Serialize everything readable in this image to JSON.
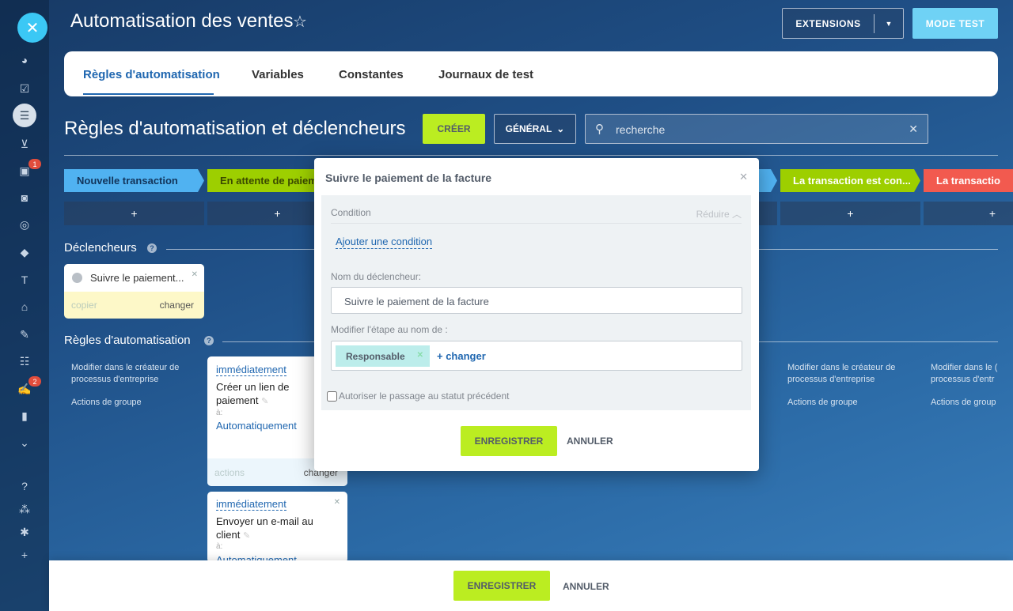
{
  "sidebar": {
    "close_icon": "✕",
    "badges": [
      "1",
      "2"
    ],
    "icons": [
      "pie-chart-icon",
      "check-square-icon",
      "funnel-icon",
      "cart-icon",
      "contact-card-icon",
      "robot-icon",
      "target-icon",
      "box-icon",
      "t-letter-icon",
      "bank-icon",
      "signature-icon",
      "checklist-icon",
      "tasks-icon",
      "bar-chart-icon",
      "chevron-down-icon",
      "help-icon",
      "sitemap-icon",
      "gear-icon",
      "plus-icon"
    ]
  },
  "header": {
    "title": "Automatisation des ventes",
    "star": "☆",
    "extensions_label": "EXTENSIONS",
    "mode_test_label": "MODE TEST"
  },
  "tabs": [
    {
      "label": "Règles d'automatisation"
    },
    {
      "label": "Variables"
    },
    {
      "label": "Constantes"
    },
    {
      "label": "Journaux de test"
    }
  ],
  "section": {
    "title": "Règles d'automatisation et déclencheurs",
    "create_label": "CRÉER",
    "general_label": "GÉNÉRAL",
    "search_placeholder": "recherche"
  },
  "stages": [
    {
      "label": "Nouvelle transaction",
      "color": "#50b2f1"
    },
    {
      "label": "En attente de paiement",
      "color": "#9dcf00"
    },
    {
      "label": "La transaction est con...",
      "color": "#9dcf00"
    },
    {
      "label": "La transactio",
      "color": "#f25a4f"
    }
  ],
  "plus_label": "+",
  "triggers": {
    "title": "Déclencheurs",
    "card": {
      "name": "Suivre le paiement...",
      "copy": "copier",
      "change": "changer"
    }
  },
  "robots": {
    "title": "Règles d'automatisation",
    "create_in_designer": "Modifier dans le créateur de processus d'entreprise",
    "create_in_designer_short": "Modifier dans le créateur de processus d'entr",
    "group_actions": "Actions de groupe",
    "group_actions_short": "Actions de group",
    "cards": [
      {
        "when": "immédiatement",
        "title": "Créer un lien de paiement",
        "to": "à:",
        "who": "Automatiquement",
        "actions": "actions",
        "change": "changer"
      },
      {
        "when": "immédiatement",
        "title": "Envoyer un e-mail au client",
        "to": "à:",
        "who": "Automatiquement"
      }
    ]
  },
  "modal": {
    "title": "Suivre le paiement de la facture",
    "condition_label": "Condition",
    "collapse_label": "Réduire",
    "add_condition": "Ajouter une condition",
    "trigger_name_label": "Nom du déclencheur:",
    "trigger_name_value": "Suivre le paiement de la facture",
    "modify_stage_label": "Modifier l'étape au nom de :",
    "tag_label": "Responsable",
    "add_change": "+ changer",
    "allow_label": "Autoriser le passage au statut précédent",
    "save_label": "ENREGISTRER",
    "cancel_label": "ANNULER"
  },
  "footer": {
    "save_label": "ENREGISTRER",
    "cancel_label": "ANNULER"
  }
}
